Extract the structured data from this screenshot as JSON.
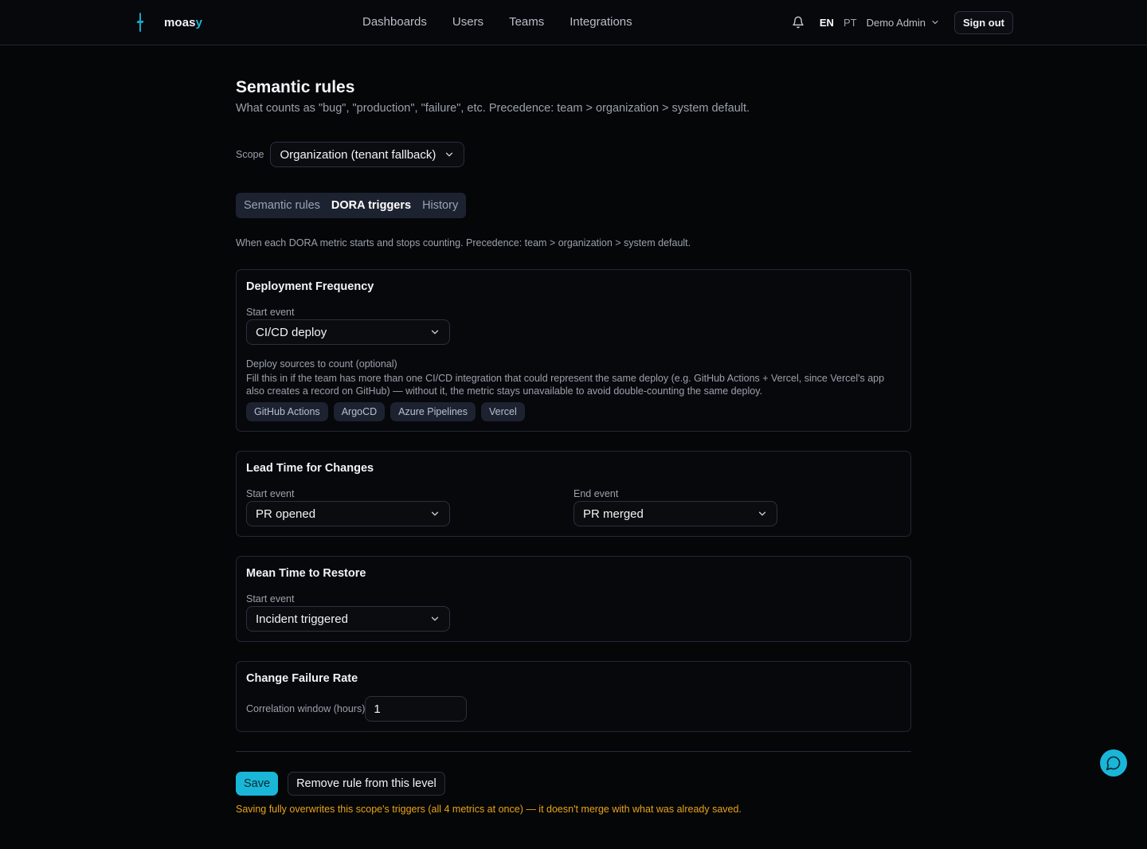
{
  "app": {
    "logo_main": "moas",
    "logo_accent": "y",
    "accent_color": "#19b6d8",
    "warning_color": "#e8a317"
  },
  "nav": {
    "items": [
      {
        "label": "Dashboards"
      },
      {
        "label": "Users"
      },
      {
        "label": "Teams"
      },
      {
        "label": "Integrations"
      }
    ]
  },
  "header": {
    "bell_icon": "bell-icon",
    "lang_en": "EN",
    "lang_pt": "PT",
    "user_name": "Demo Admin",
    "signout_label": "Sign out"
  },
  "page": {
    "title": "Semantic rules",
    "subtitle": "What counts as \"bug\", \"production\", \"failure\", etc. Precedence: team > organization > system default.",
    "scope_label": "Scope",
    "scope_value": "Organization (tenant fallback)",
    "tabs": [
      {
        "label": "Semantic rules",
        "active": false
      },
      {
        "label": "DORA triggers",
        "active": true
      },
      {
        "label": "History",
        "active": false
      }
    ],
    "description": "When each DORA metric starts and stops counting. Precedence: team > organization > system default."
  },
  "cards": {
    "deployment": {
      "title": "Deployment Frequency",
      "start_label": "Start event",
      "start_value": "CI/CD deploy",
      "sources_label": "Deploy sources to count (optional)",
      "sources_hint": "Fill this in if the team has more than one CI/CD integration that could represent the same deploy (e.g. GitHub Actions + Vercel, since Vercel's app also creates a record on GitHub) — without it, the metric stays unavailable to avoid double-counting the same deploy.",
      "sources": [
        "GitHub Actions",
        "ArgoCD",
        "Azure Pipelines",
        "Vercel"
      ]
    },
    "lead_time": {
      "title": "Lead Time for Changes",
      "start_label": "Start event",
      "start_value": "PR opened",
      "end_label": "End event",
      "end_value": "PR merged"
    },
    "mttr": {
      "title": "Mean Time to Restore",
      "start_label": "Start event",
      "start_value": "Incident triggered"
    },
    "cfr": {
      "title": "Change Failure Rate",
      "window_label": "Correlation window (hours)",
      "window_value": "1"
    }
  },
  "actions": {
    "save_label": "Save",
    "remove_label": "Remove rule from this level",
    "warning": "Saving fully overwrites this scope's triggers (all 4 metrics at once) — it doesn't merge with what was already saved."
  }
}
